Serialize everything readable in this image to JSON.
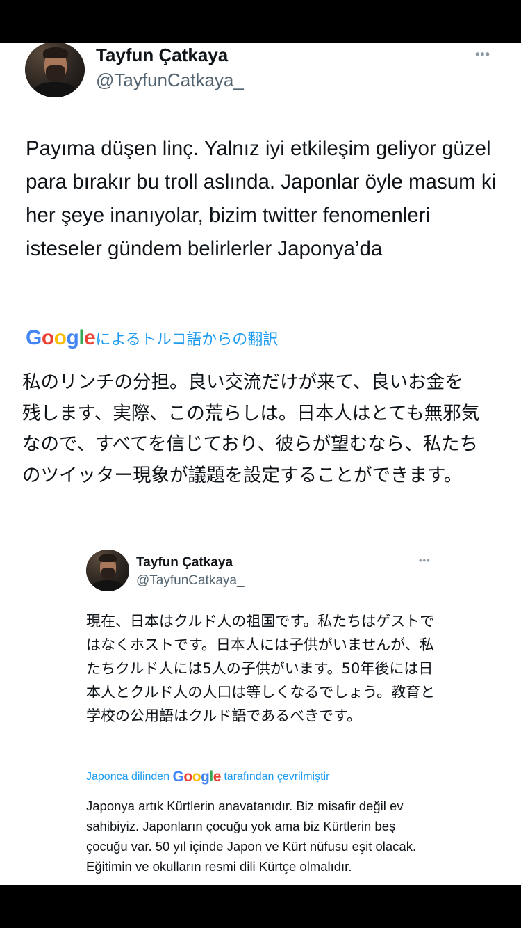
{
  "tweet": {
    "author_name": "Tayfun Çatkaya",
    "author_handle": "@TayfunCatkaya_",
    "more_icon": "•••",
    "text": "Payıma düşen linç. Yalnız iyi etkileşim geliyor güzel para bırakır bu troll aslında. Japonlar öyle masum ki her şeye inanıyolar, bizim twitter fenomenleri isteseler gündem belirlerler Japonya’da",
    "translation_logo": "Google",
    "translation_label": "によるトルコ語からの翻訳",
    "translated_text": "私のリンチの分担。良い交流だけが来て、良いお金を残します、実際、この荒らしは。日本人はとても無邪気なので、すべてを信じており、彼らが望むなら、私たちのツイッター現象が議題を設定することができます。"
  },
  "quoted": {
    "author_name": "Tayfun Çatkaya",
    "author_handle": "@TayfunCatkaya_",
    "more_icon": "•••",
    "text": "現在、日本はクルド人の祖国です。私たちはゲストではなくホストです。日本人には子供がいませんが、私たちクルド人には5人の子供がいます。50年後には日本人とクルド人の人口は等しくなるでしょう。教育と学校の公用語はクルド語であるべきです。",
    "translation_prefix": "Japonca dilinden ",
    "translation_logo": "Google",
    "translation_suffix": " tarafından çevrilmiştir",
    "translated_text": "Japonya artık Kürtlerin anavatanıdır. Biz misafir değil ev sahibiyiz. Japonların çocuğu yok ama biz Kürtlerin beş çocuğu var. 50 yıl içinde Japon ve Kürt nüfusu eşit olacak. Eğitimin ve okulların resmi dili Kürtçe olmalıdır."
  },
  "colors": {
    "link_blue": "#1d9bf0",
    "secondary_text": "#536471",
    "google_blue": "#4285F4",
    "google_red": "#EA4335",
    "google_yellow": "#FBBC05",
    "google_green": "#34A853"
  }
}
